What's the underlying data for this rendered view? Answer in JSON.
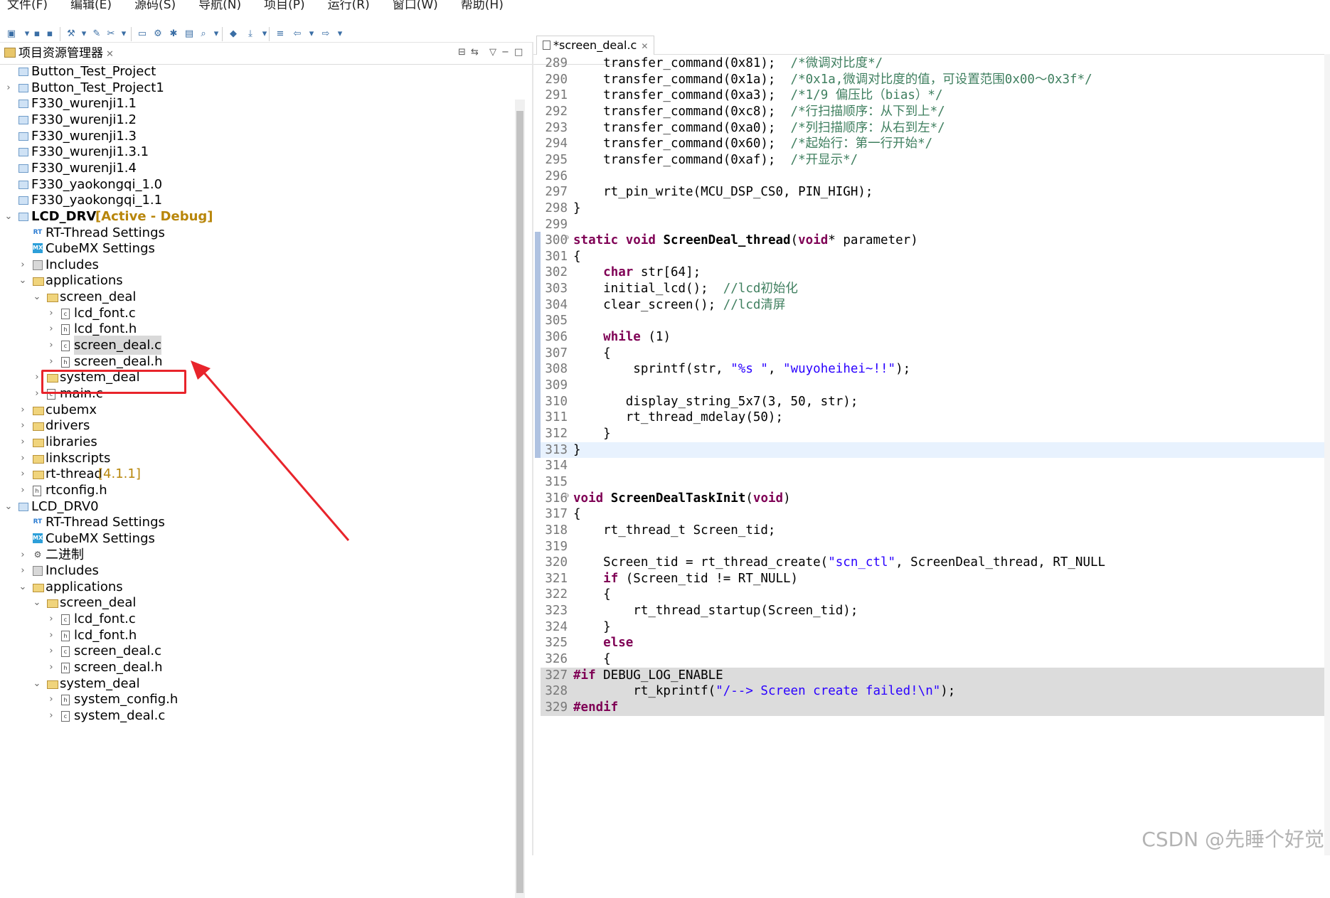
{
  "menubar": [
    "文件(F)",
    "编辑(E)",
    "源码(S)",
    "导航(N)",
    "项目(P)",
    "运行(R)",
    "窗口(W)",
    "帮助(H)"
  ],
  "left_panel": {
    "title": "项目资源管理器",
    "tree": [
      {
        "label": "Button_Test_Project",
        "depth": 0,
        "icon": "project-icon",
        "arrow": ""
      },
      {
        "label": "Button_Test_Project1",
        "depth": 0,
        "icon": "project-icon",
        "arrow": "›"
      },
      {
        "label": "F330_wurenji1.1",
        "depth": 0,
        "icon": "project-icon",
        "arrow": ""
      },
      {
        "label": "F330_wurenji1.2",
        "depth": 0,
        "icon": "project-icon",
        "arrow": ""
      },
      {
        "label": "F330_wurenji1.3",
        "depth": 0,
        "icon": "project-icon",
        "arrow": ""
      },
      {
        "label": "F330_wurenji1.3.1",
        "depth": 0,
        "icon": "project-icon",
        "arrow": ""
      },
      {
        "label": "F330_wurenji1.4",
        "depth": 0,
        "icon": "project-icon",
        "arrow": ""
      },
      {
        "label": "F330_yaokongqi_1.0",
        "depth": 0,
        "icon": "project-icon",
        "arrow": ""
      },
      {
        "label": "F330_yaokongqi_1.1",
        "depth": 0,
        "icon": "project-icon",
        "arrow": ""
      },
      {
        "label": "LCD_DRV",
        "depth": 0,
        "icon": "project-icon",
        "arrow": "⌄",
        "bold": true,
        "status": "[Active - Debug]"
      },
      {
        "label": "RT-Thread Settings",
        "depth": 1,
        "icon": "rt-thread-icon",
        "arrow": ""
      },
      {
        "label": "CubeMX Settings",
        "depth": 1,
        "icon": "cubemx-icon",
        "arrow": ""
      },
      {
        "label": "Includes",
        "depth": 1,
        "icon": "includes-icon",
        "arrow": "›"
      },
      {
        "label": "applications",
        "depth": 1,
        "icon": "folder-icon",
        "arrow": "⌄"
      },
      {
        "label": "screen_deal",
        "depth": 2,
        "icon": "folder-icon",
        "arrow": "⌄"
      },
      {
        "label": "lcd_font.c",
        "depth": 3,
        "icon": "c-file-icon",
        "arrow": "›"
      },
      {
        "label": "lcd_font.h",
        "depth": 3,
        "icon": "h-file-icon",
        "arrow": "›"
      },
      {
        "label": "screen_deal.c",
        "depth": 3,
        "icon": "c-file-icon",
        "arrow": "›",
        "selected": true
      },
      {
        "label": "screen_deal.h",
        "depth": 3,
        "icon": "h-file-icon",
        "arrow": "›"
      },
      {
        "label": "system_deal",
        "depth": 2,
        "icon": "folder-icon",
        "arrow": "›"
      },
      {
        "label": "main.c",
        "depth": 2,
        "icon": "c-file-icon",
        "arrow": "›"
      },
      {
        "label": "cubemx",
        "depth": 1,
        "icon": "folder-icon",
        "arrow": "›"
      },
      {
        "label": "drivers",
        "depth": 1,
        "icon": "folder-icon",
        "arrow": "›"
      },
      {
        "label": "libraries",
        "depth": 1,
        "icon": "folder-icon",
        "arrow": "›"
      },
      {
        "label": "linkscripts",
        "depth": 1,
        "icon": "folder-icon",
        "arrow": "›"
      },
      {
        "label": "rt-thread",
        "depth": 1,
        "icon": "folder-icon",
        "arrow": "›",
        "version": "[4.1.1]"
      },
      {
        "label": "rtconfig.h",
        "depth": 1,
        "icon": "h-file-icon",
        "arrow": "›"
      },
      {
        "label": "LCD_DRV0",
        "depth": 0,
        "icon": "project-icon",
        "arrow": "⌄"
      },
      {
        "label": "RT-Thread Settings",
        "depth": 1,
        "icon": "rt-thread-icon",
        "arrow": ""
      },
      {
        "label": "CubeMX Settings",
        "depth": 1,
        "icon": "cubemx-icon",
        "arrow": ""
      },
      {
        "label": "二进制",
        "depth": 1,
        "icon": "binaries-icon",
        "arrow": "›"
      },
      {
        "label": "Includes",
        "depth": 1,
        "icon": "includes-icon",
        "arrow": "›"
      },
      {
        "label": "applications",
        "depth": 1,
        "icon": "folder-icon",
        "arrow": "⌄"
      },
      {
        "label": "screen_deal",
        "depth": 2,
        "icon": "folder-icon",
        "arrow": "⌄"
      },
      {
        "label": "lcd_font.c",
        "depth": 3,
        "icon": "c-file-icon",
        "arrow": "›"
      },
      {
        "label": "lcd_font.h",
        "depth": 3,
        "icon": "h-file-icon",
        "arrow": "›"
      },
      {
        "label": "screen_deal.c",
        "depth": 3,
        "icon": "c-file-icon",
        "arrow": "›"
      },
      {
        "label": "screen_deal.h",
        "depth": 3,
        "icon": "h-file-icon",
        "arrow": "›"
      },
      {
        "label": "system_deal",
        "depth": 2,
        "icon": "folder-icon",
        "arrow": "⌄"
      },
      {
        "label": "system_config.h",
        "depth": 3,
        "icon": "h-file-icon",
        "arrow": "›"
      },
      {
        "label": "system_deal.c",
        "depth": 3,
        "icon": "c-file-icon",
        "arrow": "›"
      }
    ]
  },
  "editor": {
    "tab_label": "*screen_deal.c",
    "lines": [
      {
        "n": "289",
        "segs": [
          [
            "",
            "    transfer_command(0x81);  "
          ],
          [
            "cmt",
            "/*微调对比度*/"
          ]
        ]
      },
      {
        "n": "290",
        "segs": [
          [
            "",
            "    transfer_command(0x1a);  "
          ],
          [
            "cmt",
            "/*0x1a,微调对比度的值，可设置范围0x00～0x3f*/"
          ]
        ]
      },
      {
        "n": "291",
        "segs": [
          [
            "",
            "    transfer_command(0xa3);  "
          ],
          [
            "cmt",
            "/*1/9 偏压比（bias）*/"
          ]
        ]
      },
      {
        "n": "292",
        "segs": [
          [
            "",
            "    transfer_command(0xc8);  "
          ],
          [
            "cmt",
            "/*行扫描顺序：从下到上*/"
          ]
        ]
      },
      {
        "n": "293",
        "segs": [
          [
            "",
            "    transfer_command(0xa0);  "
          ],
          [
            "cmt",
            "/*列扫描顺序：从右到左*/"
          ]
        ]
      },
      {
        "n": "294",
        "segs": [
          [
            "",
            "    transfer_command(0x60);  "
          ],
          [
            "cmt",
            "/*起始行：第一行开始*/"
          ]
        ]
      },
      {
        "n": "295",
        "segs": [
          [
            "",
            "    transfer_command(0xaf);  "
          ],
          [
            "cmt",
            "/*开显示*/"
          ]
        ]
      },
      {
        "n": "296",
        "segs": []
      },
      {
        "n": "297",
        "segs": [
          [
            "",
            "    rt_pin_write(MCU_DSP_CS0, PIN_HIGH);"
          ]
        ]
      },
      {
        "n": "298",
        "segs": [
          [
            "",
            "}"
          ]
        ]
      },
      {
        "n": "299",
        "segs": []
      },
      {
        "n": "300",
        "fold": true,
        "segs": [
          [
            "kw",
            "static"
          ],
          [
            "",
            " "
          ],
          [
            "kw",
            "void"
          ],
          [
            "",
            " "
          ],
          [
            "fn",
            "ScreenDeal_thread"
          ],
          [
            "",
            "("
          ],
          [
            "kw",
            "void"
          ],
          [
            "",
            "* parameter)"
          ]
        ]
      },
      {
        "n": "301",
        "segs": [
          [
            "",
            "{"
          ]
        ]
      },
      {
        "n": "302",
        "segs": [
          [
            "",
            "    "
          ],
          [
            "kw",
            "char"
          ],
          [
            "",
            " str[64];"
          ]
        ]
      },
      {
        "n": "303",
        "segs": [
          [
            "",
            "    initial_lcd();  "
          ],
          [
            "cmt",
            "//lcd初始化"
          ]
        ]
      },
      {
        "n": "304",
        "segs": [
          [
            "",
            "    clear_screen(); "
          ],
          [
            "cmt",
            "//lcd清屏"
          ]
        ]
      },
      {
        "n": "305",
        "segs": []
      },
      {
        "n": "306",
        "segs": [
          [
            "",
            "    "
          ],
          [
            "kw",
            "while"
          ],
          [
            "",
            " (1)"
          ]
        ]
      },
      {
        "n": "307",
        "segs": [
          [
            "",
            "    {"
          ]
        ]
      },
      {
        "n": "308",
        "segs": [
          [
            "",
            "        sprintf(str, "
          ],
          [
            "str",
            "\"%s \""
          ],
          [
            "",
            ", "
          ],
          [
            "str",
            "\"wuyoheihei~!!\""
          ],
          [
            "",
            ");"
          ]
        ]
      },
      {
        "n": "309",
        "segs": []
      },
      {
        "n": "310",
        "segs": [
          [
            "",
            "       display_string_5x7(3, 50, str);"
          ]
        ]
      },
      {
        "n": "311",
        "segs": [
          [
            "",
            "       rt_thread_mdelay(50);"
          ]
        ]
      },
      {
        "n": "312",
        "segs": [
          [
            "",
            "    }"
          ]
        ]
      },
      {
        "n": "313",
        "cur": true,
        "segs": [
          [
            "",
            "}"
          ]
        ]
      },
      {
        "n": "314",
        "segs": []
      },
      {
        "n": "315",
        "segs": []
      },
      {
        "n": "316",
        "fold": true,
        "segs": [
          [
            "kw",
            "void"
          ],
          [
            "",
            " "
          ],
          [
            "fn",
            "ScreenDealTaskInit"
          ],
          [
            "",
            "("
          ],
          [
            "kw",
            "void"
          ],
          [
            "",
            ")"
          ]
        ]
      },
      {
        "n": "317",
        "segs": [
          [
            "",
            "{"
          ]
        ]
      },
      {
        "n": "318",
        "segs": [
          [
            "",
            "    rt_thread_t Screen_tid;"
          ]
        ]
      },
      {
        "n": "319",
        "segs": []
      },
      {
        "n": "320",
        "segs": [
          [
            "",
            "    Screen_tid = rt_thread_create("
          ],
          [
            "str",
            "\"scn_ctl\""
          ],
          [
            "",
            ", ScreenDeal_thread, RT_NULL"
          ]
        ]
      },
      {
        "n": "321",
        "segs": [
          [
            "",
            "    "
          ],
          [
            "kw",
            "if"
          ],
          [
            "",
            " (Screen_tid != RT_NULL)"
          ]
        ]
      },
      {
        "n": "322",
        "segs": [
          [
            "",
            "    {"
          ]
        ]
      },
      {
        "n": "323",
        "segs": [
          [
            "",
            "        rt_thread_startup(Screen_tid);"
          ]
        ]
      },
      {
        "n": "324",
        "segs": [
          [
            "",
            "    }"
          ]
        ]
      },
      {
        "n": "325",
        "segs": [
          [
            "",
            "    "
          ],
          [
            "kw",
            "else"
          ]
        ]
      },
      {
        "n": "326",
        "segs": [
          [
            "",
            "    {"
          ]
        ]
      },
      {
        "n": "327",
        "pp": true,
        "segs": [
          [
            "kw",
            "#if"
          ],
          [
            "",
            " DEBUG_LOG_ENABLE"
          ]
        ]
      },
      {
        "n": "328",
        "pp": true,
        "segs": [
          [
            "",
            "        rt_kprintf("
          ],
          [
            "str",
            "\"/--> Screen create failed!\\n\""
          ],
          [
            "",
            ");"
          ]
        ]
      },
      {
        "n": "329",
        "pp": true,
        "segs": [
          [
            "kw",
            "#endif"
          ]
        ]
      }
    ]
  },
  "watermark": "CSDN @先睡个好觉"
}
